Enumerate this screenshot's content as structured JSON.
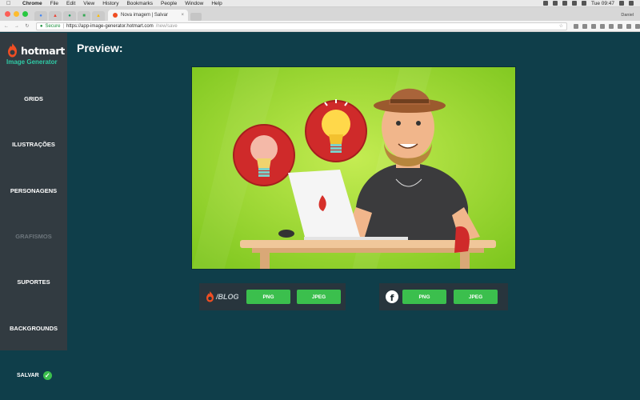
{
  "menubar": {
    "app": "Chrome",
    "items": [
      "File",
      "Edit",
      "View",
      "History",
      "Bookmarks",
      "People",
      "Window",
      "Help"
    ],
    "clock": "Tue 09:47"
  },
  "browser": {
    "active_tab": "Nova imagem | Salvar",
    "user": "Daniel",
    "url_secure": "Secure",
    "url_host": "https://app-image-generator.hotmart.com",
    "url_path": "/new/save"
  },
  "sidebar": {
    "brand": "hotmart",
    "subtitle": "Image Generator",
    "items": [
      {
        "label": "GRIDS"
      },
      {
        "label": "ILUSTRAÇÕES"
      },
      {
        "label": "PERSONAGENS"
      },
      {
        "label": "GRAFISMOS"
      },
      {
        "label": "SUPORTES"
      },
      {
        "label": "BACKGROUNDS"
      }
    ],
    "save_label": "SALVAR"
  },
  "main": {
    "title": "Preview:",
    "blog_label": "/BLOG",
    "blog_png": "PNG",
    "blog_jpeg": "JPEG",
    "fb_letter": "f",
    "fb_png": "PNG",
    "fb_jpeg": "JPEG"
  },
  "colors": {
    "app_bg": "#0f3e4a",
    "sidebar": "#323b41",
    "accent_green": "#3bbf4d",
    "brand_teal": "#2fc9a5",
    "preview_bg": "#9bd52a"
  }
}
